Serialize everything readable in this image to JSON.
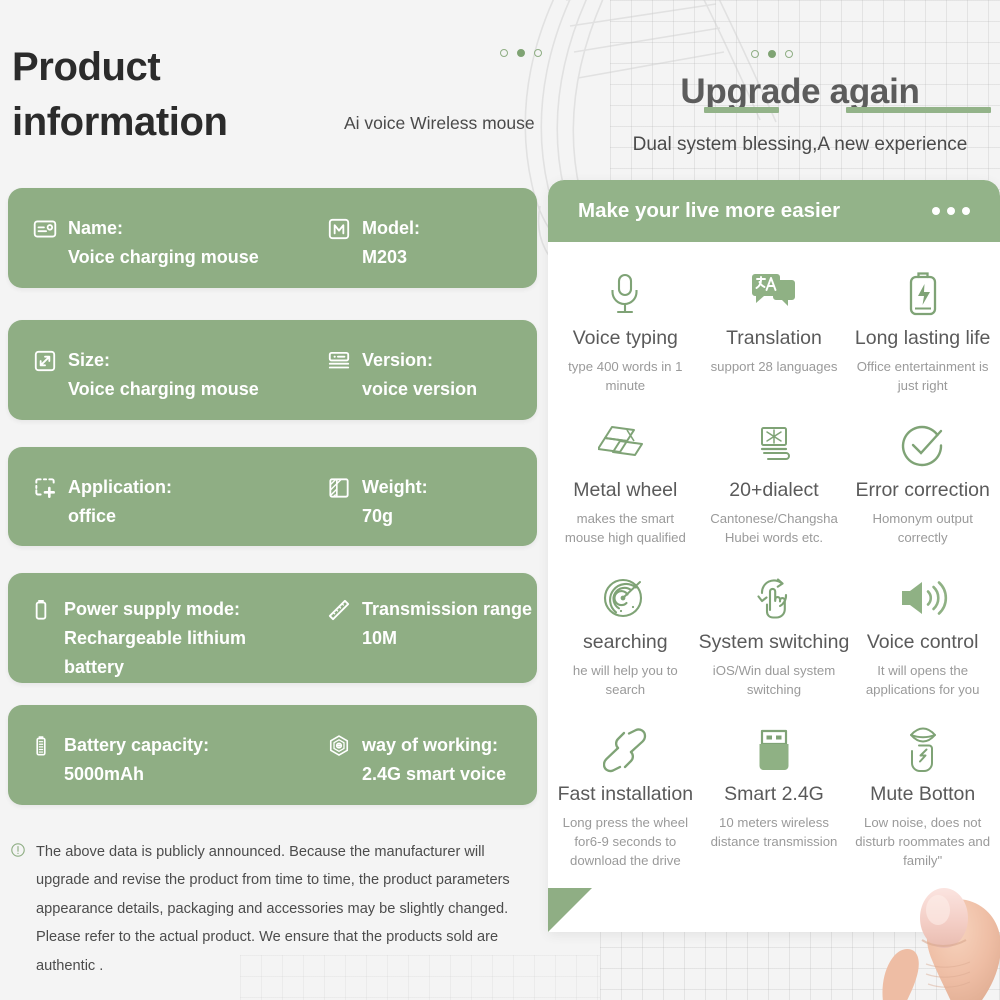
{
  "left": {
    "title": "Product information",
    "subtitle": "Ai voice Wireless mouse",
    "spec_cards": [
      {
        "left": {
          "icon": "id-card-icon",
          "label": "Name:",
          "value": "Voice charging mouse"
        },
        "right": {
          "icon": "model-m-icon",
          "label": "Model:",
          "value": "M203"
        }
      },
      {
        "left": {
          "icon": "resize-icon",
          "label": "Size:",
          "value": "Voice charging mouse"
        },
        "right": {
          "icon": "version-icon",
          "label": "Version:",
          "value": "voice version"
        }
      },
      {
        "left": {
          "icon": "application-icon",
          "label": "Application:",
          "value": "office"
        },
        "right": {
          "icon": "weight-icon",
          "label": "Weight:",
          "value": "70g"
        }
      },
      {
        "left": {
          "icon": "battery-icon",
          "label": "Power supply mode:",
          "value": "Rechargeable lithium",
          "value2": "battery"
        },
        "right": {
          "icon": "ruler-icon",
          "label": "Transmission range",
          "value": "10M"
        }
      },
      {
        "left": {
          "icon": "battery-level-icon",
          "label": "Battery capacity:",
          "value": "5000mAh"
        },
        "right": {
          "icon": "hexagon-chip-icon",
          "label": "way of working:",
          "value": "2.4G smart voice"
        }
      }
    ],
    "disclaimer": {
      "icon": "exclamation-circle-icon",
      "text": "The above data is publicly announced. Because the manufacturer will upgrade and revise the product from time to time, the product parameters appearance details, packaging and accessories may be slightly changed. Please refer to the actual product. We ensure that the products sold are authentic ."
    }
  },
  "right": {
    "title": "Upgrade again",
    "subtitle": "Dual system blessing,A new experience",
    "panel": {
      "header_title": "Make your live more easier",
      "features": [
        {
          "icon": "microphone-icon",
          "title": "Voice typing",
          "desc": "type 400 words in 1 minute"
        },
        {
          "icon": "translate-bubble-icon",
          "title": "Translation",
          "desc": "support 28 languages"
        },
        {
          "icon": "battery-charge-icon",
          "title": "Long lasting life",
          "desc": "Office entertainment is just right"
        },
        {
          "icon": "metal-bars-icon",
          "title": "Metal wheel",
          "desc": "makes the smart mouse high qualified"
        },
        {
          "icon": "dialect-screen-icon",
          "title": "20+dialect",
          "desc": "Cantonese/Changsha Hubei words etc."
        },
        {
          "icon": "check-circle-icon",
          "title": "Error correction",
          "desc": "Homonym output correctly"
        },
        {
          "icon": "radar-search-icon",
          "title": "searching",
          "desc": "he will help you to search"
        },
        {
          "icon": "switch-hand-icon",
          "title": "System switching",
          "desc": "iOS/Win dual system switching"
        },
        {
          "icon": "speaker-icon",
          "title": "Voice control",
          "desc": "It will opens the applications for you"
        },
        {
          "icon": "link-chain-icon",
          "title": "Fast installation",
          "desc": "Long press the wheel for6-9 seconds to download the drive"
        },
        {
          "icon": "usb-dongle-icon",
          "title": "Smart 2.4G",
          "desc": "10 meters wireless distance transmission"
        },
        {
          "icon": "mute-mouth-icon",
          "title": "Mute Botton",
          "desc": "Low noise, does not disturb roommates and family\""
        }
      ]
    }
  },
  "colors": {
    "card_green": "#8fae84",
    "header_green": "#93b389",
    "icon_green": "#7fa376",
    "page_bg": "#f4f4f4",
    "panel_bg": "#ffffff"
  }
}
